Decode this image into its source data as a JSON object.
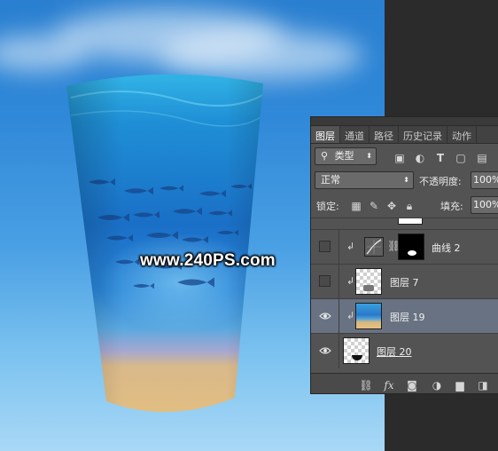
{
  "watermark": "www.240PS.com",
  "panel": {
    "tabs": [
      "图层",
      "通道",
      "路径",
      "历史记录",
      "动作"
    ],
    "active_tab": "图层",
    "filter_kind": "类型",
    "blend_mode": "正常",
    "opacity_label": "不透明度:",
    "opacity_value": "100%",
    "lock_label": "锁定:",
    "fill_label": "填充:",
    "fill_value": "100%",
    "layers": [
      {
        "name": "曲线 2",
        "visible": false,
        "clipped": true,
        "type": "curves-adjustment"
      },
      {
        "name": "图层 7",
        "visible": false,
        "clipped": true,
        "type": "pixel"
      },
      {
        "name": "图层 19",
        "visible": true,
        "clipped": true,
        "type": "pixel",
        "selected": true
      },
      {
        "name": "图层 20",
        "visible": true,
        "clipped": false,
        "type": "pixel"
      }
    ],
    "bottom_icons": [
      "link-icon",
      "fx-icon",
      "add-mask-icon",
      "adjustment-layer-icon",
      "group-folder-icon",
      "new-layer-icon"
    ],
    "fx_label": "fx"
  },
  "colors": {
    "panel_bg": "#535353",
    "selected_layer": "#687282",
    "sky_top": "#2a7fd0",
    "sky_bottom": "#a9d8f6"
  }
}
